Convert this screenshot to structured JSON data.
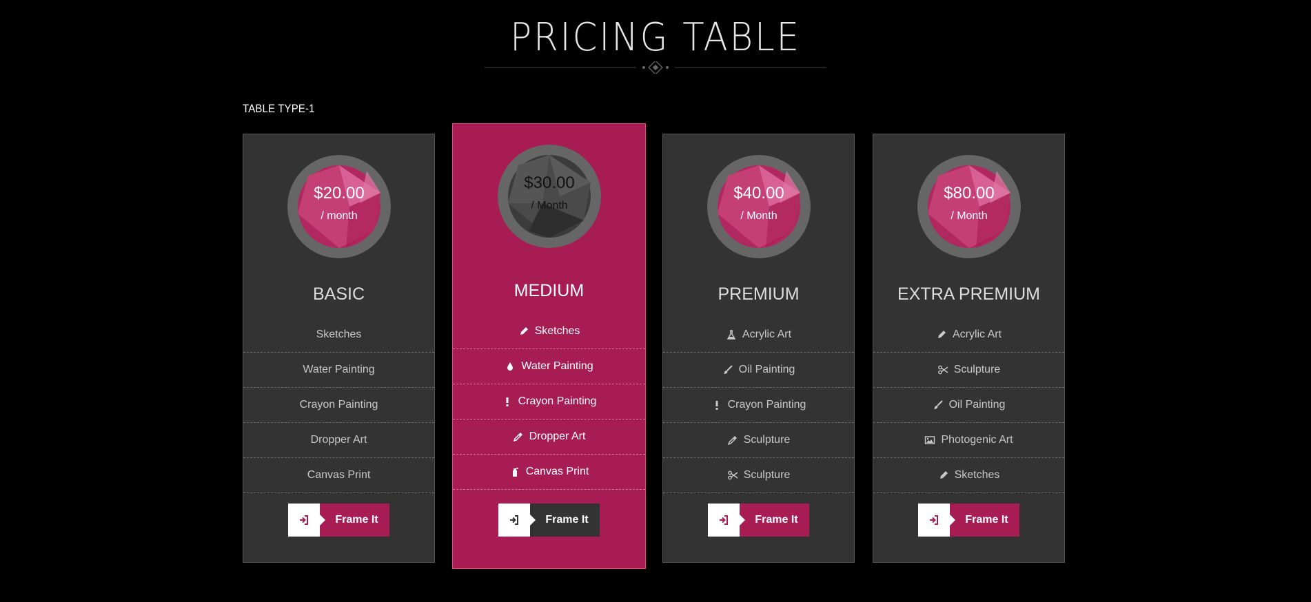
{
  "header": {
    "title": "PRICING TABLE",
    "section_label": "TABLE TYPE-1"
  },
  "colors": {
    "accent": "#a71c52",
    "card_bg": "#333333",
    "badge_ring": "#666666"
  },
  "plans": [
    {
      "price": "$20.00",
      "period": "/ month",
      "name": "BASIC",
      "featured": false,
      "features": [
        {
          "label": "Sketches",
          "icon": "none"
        },
        {
          "label": "Water Painting",
          "icon": "none"
        },
        {
          "label": "Crayon Painting",
          "icon": "none"
        },
        {
          "label": "Dropper Art",
          "icon": "none"
        },
        {
          "label": "Canvas Print",
          "icon": "none"
        }
      ],
      "cta_label": "Frame It",
      "cta_icon": "sign-in-icon"
    },
    {
      "price": "$30.00",
      "period": "/ Month",
      "name": "MEDIUM",
      "featured": true,
      "features": [
        {
          "label": "Sketches",
          "icon": "pencil-icon"
        },
        {
          "label": "Water Painting",
          "icon": "droplet-icon"
        },
        {
          "label": "Crayon Painting",
          "icon": "exclamation-icon"
        },
        {
          "label": "Dropper Art",
          "icon": "eyedropper-icon"
        },
        {
          "label": "Canvas Print",
          "icon": "spray-bottle-icon"
        }
      ],
      "cta_label": "Frame It",
      "cta_icon": "sign-in-icon"
    },
    {
      "price": "$40.00",
      "period": "/ Month",
      "name": "PREMIUM",
      "featured": false,
      "features": [
        {
          "label": "Acrylic Art",
          "icon": "flask-icon"
        },
        {
          "label": "Oil Painting",
          "icon": "brush-icon"
        },
        {
          "label": "Crayon Painting",
          "icon": "exclamation-icon"
        },
        {
          "label": "Sculpture",
          "icon": "eyedropper-icon"
        },
        {
          "label": "Sculpture",
          "icon": "scissors-icon"
        }
      ],
      "cta_label": "Frame It",
      "cta_icon": "sign-in-icon"
    },
    {
      "price": "$80.00",
      "period": "/ Month",
      "name": "EXTRA PREMIUM",
      "featured": false,
      "features": [
        {
          "label": "Acrylic Art",
          "icon": "pencil-icon"
        },
        {
          "label": "Sculpture",
          "icon": "scissors-icon"
        },
        {
          "label": "Oil Painting",
          "icon": "brush-icon"
        },
        {
          "label": "Photogenic Art",
          "icon": "picture-icon"
        },
        {
          "label": "Sketches",
          "icon": "pencil-icon"
        }
      ],
      "cta_label": "Frame It",
      "cta_icon": "sign-in-icon"
    }
  ]
}
